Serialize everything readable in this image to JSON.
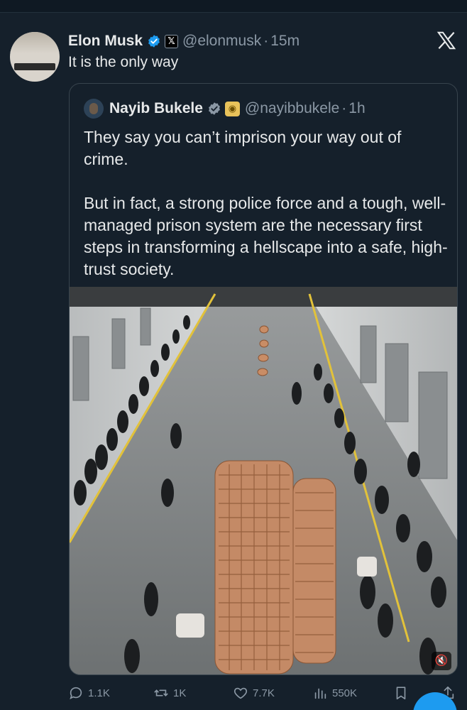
{
  "tweet": {
    "author_name": "Elon Musk",
    "author_handle": "@elonmusk",
    "separator": "·",
    "time": "15m",
    "text": "It is the only way",
    "avatar_icon": "crowd-avatar-icon"
  },
  "header": {
    "close_icon": "x-logo-icon",
    "close_glyph": "X"
  },
  "quote": {
    "author_name": "Nayib Bukele",
    "author_handle": "@nayibbukele",
    "separator": "·",
    "time": "1h",
    "paragraphs": [
      "They say you can’t imprison your way out of crime.",
      "But in fact, a strong police force and a tough, well-managed prison system are the necessary first steps in transforming a hellscape into a safe, high-trust society."
    ],
    "media_mute_icon": "speaker-muted-icon"
  },
  "actions": {
    "replies": "1.1K",
    "reposts": "1K",
    "likes": "7.7K",
    "views": "550K"
  },
  "colors": {
    "background": "#15202b",
    "text": "#e7e9ea",
    "muted": "#8b98a5",
    "verified": "#1d9bf0",
    "border": "#38444d"
  }
}
